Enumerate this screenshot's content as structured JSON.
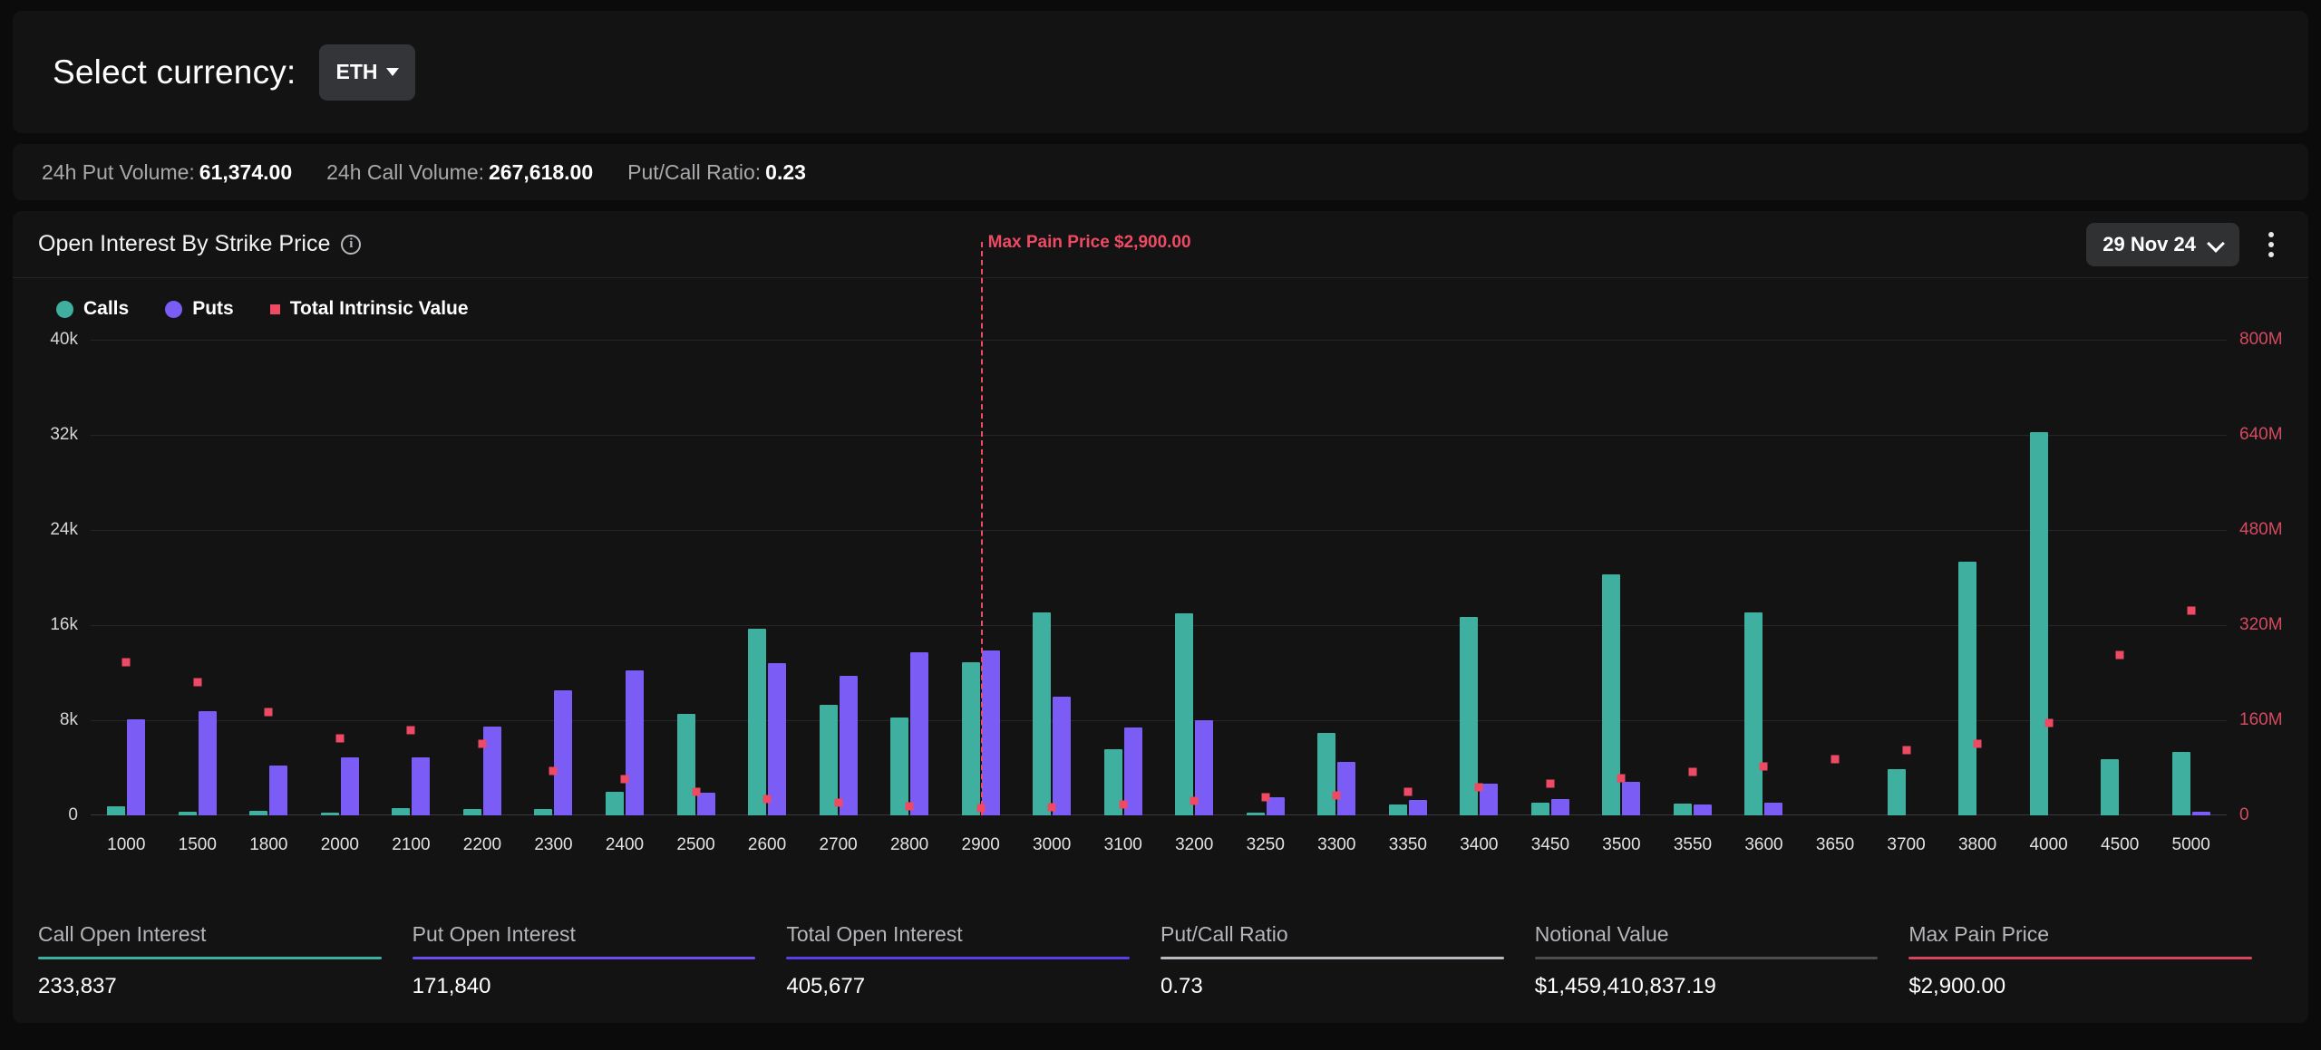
{
  "currency_bar": {
    "label": "Select currency:",
    "selected": "ETH"
  },
  "volume_stats": [
    {
      "label": "24h Put Volume:",
      "value": "61,374.00"
    },
    {
      "label": "24h Call Volume:",
      "value": "267,618.00"
    },
    {
      "label": "Put/Call Ratio:",
      "value": "0.23"
    }
  ],
  "chart_card": {
    "title": "Open Interest By Strike Price",
    "info_icon": "info-icon",
    "date_selector": "29 Nov 24",
    "menu_icon": "kebab-menu-icon"
  },
  "legend": [
    {
      "label": "Calls",
      "color": "#3fb0a0",
      "marker": "circle"
    },
    {
      "label": "Puts",
      "color": "#7b5cf5",
      "marker": "circle"
    },
    {
      "label": "Total Intrinsic Value",
      "color": "#ef4a63",
      "marker": "square"
    }
  ],
  "footer_stats": [
    {
      "label": "Call Open Interest",
      "value": "233,837",
      "color": "#3fb0a0"
    },
    {
      "label": "Put Open Interest",
      "value": "171,840",
      "color": "#6d4df0"
    },
    {
      "label": "Total Open Interest",
      "value": "405,677",
      "color": "#5b3fe8"
    },
    {
      "label": "Put/Call Ratio",
      "value": "0.73",
      "color": "#b9b9bd"
    },
    {
      "label": "Notional Value",
      "value": "$1,459,410,837.19",
      "color": "#4d4d50"
    },
    {
      "label": "Max Pain Price",
      "value": "$2,900.00",
      "color": "#d9465c"
    }
  ],
  "chart_data": {
    "type": "bar",
    "title": "Open Interest By Strike Price",
    "xlabel": "",
    "ylabel": "Open Interest",
    "y2label": "Total Intrinsic Value",
    "ylim": [
      0,
      40000
    ],
    "y2lim": [
      0,
      800000000
    ],
    "yticks": [
      "0",
      "8k",
      "16k",
      "24k",
      "32k",
      "40k"
    ],
    "ytick_values": [
      0,
      8000,
      16000,
      24000,
      32000,
      40000
    ],
    "y2ticks": [
      "0",
      "160M",
      "320M",
      "480M",
      "640M",
      "800M"
    ],
    "y2tick_values": [
      0,
      160000000,
      320000000,
      480000000,
      640000000,
      800000000
    ],
    "grid": true,
    "legend_position": "top-left",
    "categories": [
      "1000",
      "1500",
      "1800",
      "2000",
      "2100",
      "2200",
      "2300",
      "2400",
      "2500",
      "2600",
      "2700",
      "2800",
      "2900",
      "3000",
      "3100",
      "3200",
      "3250",
      "3300",
      "3350",
      "3400",
      "3450",
      "3500",
      "3550",
      "3600",
      "3650",
      "3700",
      "3800",
      "4000",
      "4500",
      "5000"
    ],
    "series": [
      {
        "name": "Calls",
        "color": "#3fb0a0",
        "axis": "left",
        "values": [
          800,
          300,
          350,
          250,
          600,
          550,
          500,
          2000,
          8500,
          15700,
          9300,
          8200,
          12900,
          17100,
          5600,
          17000,
          250,
          6900,
          900,
          16700,
          1100,
          20300,
          1000,
          17100,
          0,
          3900,
          21300,
          32200,
          4700,
          5300
        ]
      },
      {
        "name": "Puts",
        "color": "#7b5cf5",
        "axis": "left",
        "values": [
          8100,
          8800,
          4200,
          4900,
          4900,
          7500,
          10500,
          12200,
          1900,
          12800,
          11700,
          13700,
          13900,
          10000,
          7400,
          8000,
          1500,
          4500,
          1300,
          2700,
          1400,
          2800,
          900,
          1100,
          0,
          0,
          0,
          0,
          0,
          300
        ]
      },
      {
        "name": "Total Intrinsic Value",
        "color": "#ef4a63",
        "axis": "right",
        "marker": "square",
        "values": [
          257000000,
          224000000,
          173000000,
          130000000,
          143000000,
          120000000,
          74000000,
          61000000,
          40000000,
          27000000,
          22000000,
          16000000,
          12000000,
          13000000,
          18000000,
          25000000,
          30000000,
          33000000,
          39000000,
          47000000,
          53000000,
          63000000,
          73000000,
          83000000,
          95000000,
          109000000,
          121000000,
          156000000,
          269000000,
          344000000
        ]
      }
    ],
    "annotations": [
      {
        "type": "vline",
        "label": "Max Pain Price $2,900.00",
        "x": "2900",
        "color": "#ef4a63",
        "style": "dashed"
      }
    ]
  }
}
